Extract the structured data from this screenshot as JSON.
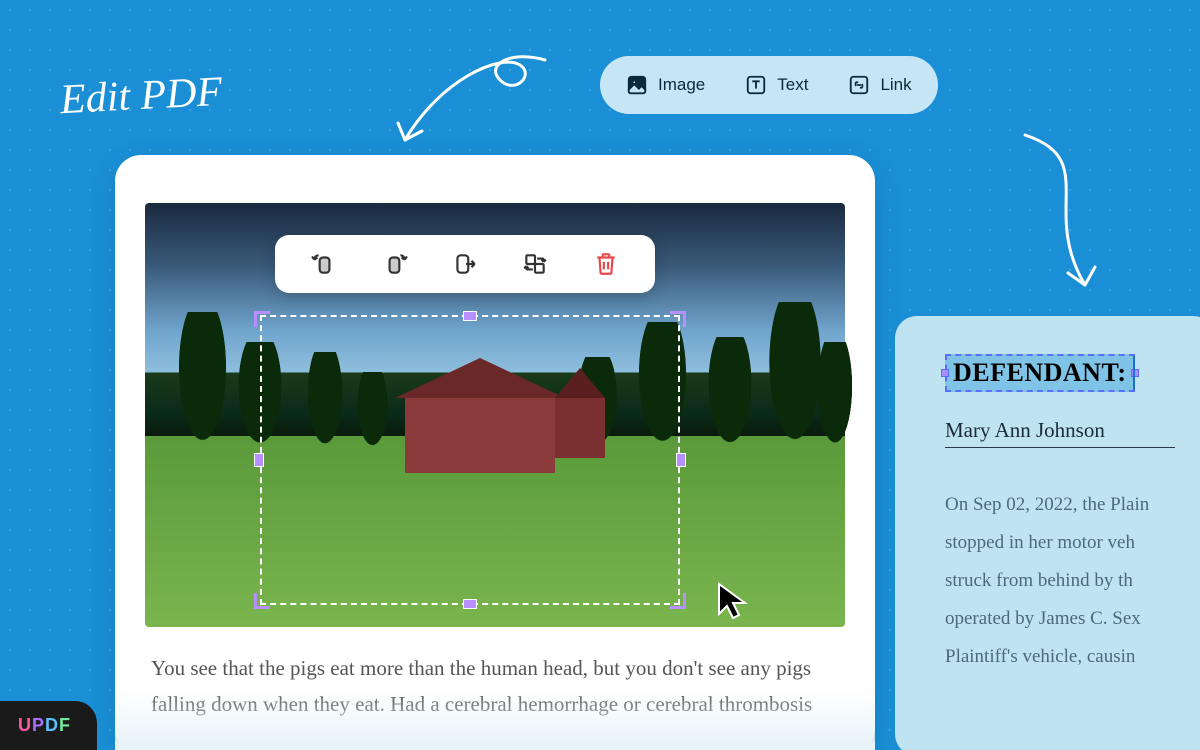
{
  "title": "Edit PDF",
  "toolbar": {
    "image": "Image",
    "text": "Text",
    "link": "Link"
  },
  "imageToolbar": {
    "rotateLeft": "rotate-left",
    "rotateRight": "rotate-right",
    "export": "export",
    "replace": "replace",
    "delete": "delete"
  },
  "document": {
    "paragraph": "You see that the pigs eat more than the human head, but you don't see any pigs falling down when they eat. Had a cerebral hemorrhage or cerebral thrombosis"
  },
  "rightCard": {
    "heading": "DEFENDANT:",
    "name": "Mary Ann Johnson",
    "body": "On Sep 02, 2022, the Plain\nstopped in her motor veh\nstruck from behind by th\noperated by James C. Sex\nPlaintiff's vehicle, causin"
  },
  "brand": {
    "u": "U",
    "p": "P",
    "d": "D",
    "f": "F"
  }
}
